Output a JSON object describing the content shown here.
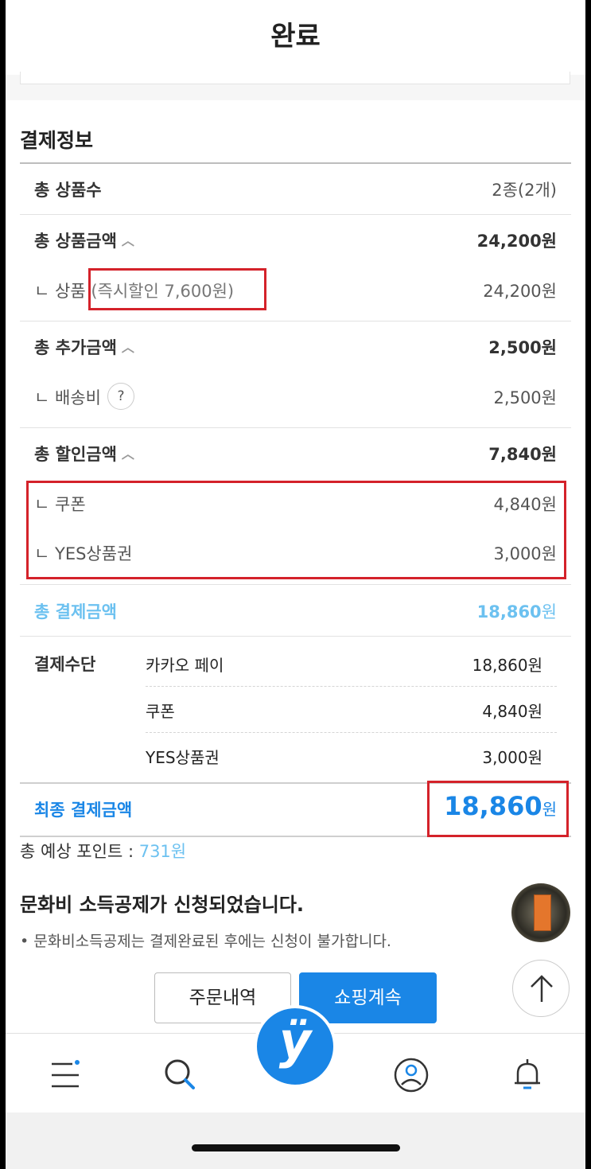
{
  "header": {
    "title": "완료"
  },
  "payment_info": {
    "section_title": "결제정보",
    "total_items": {
      "label": "총 상품수",
      "value": "2종(2개)"
    },
    "total_product_amount": {
      "label": "총 상품금액",
      "value": "24,200원"
    },
    "product_sub": {
      "label": "ㄴ 상품",
      "discount_note": "(즉시할인 7,600원)",
      "value": "24,200원"
    },
    "total_extra_amount": {
      "label": "총 추가금액",
      "value": "2,500원"
    },
    "shipping_sub": {
      "label": "ㄴ 배송비",
      "help": "?",
      "value": "2,500원"
    },
    "total_discount": {
      "label": "총 할인금액",
      "value": "7,840원"
    },
    "coupon_sub": {
      "label": "ㄴ 쿠폰",
      "value": "4,840원"
    },
    "giftcard_sub": {
      "label": "ㄴ YES상품권",
      "value": "3,000원"
    },
    "total_payment": {
      "label": "총 결제금액",
      "value": "18,860",
      "unit": "원"
    },
    "payment_method": {
      "label": "결제수단",
      "items": [
        {
          "name": "카카오 페이",
          "value": "18,860원"
        },
        {
          "name": "쿠폰",
          "value": "4,840원"
        },
        {
          "name": "YES상품권",
          "value": "3,000원"
        }
      ]
    },
    "final_payment": {
      "label": "최종 결제금액",
      "value": "18,860",
      "unit": "원"
    },
    "expected_points": {
      "label": "총 예상 포인트 : ",
      "value": "731원"
    }
  },
  "notice": {
    "title": "문화비 소득공제가 신청되었습니다.",
    "text": "• 문화비소득공제는 결제완료된 후에는 신청이 불가합니다."
  },
  "buttons": {
    "order_history": "주문내역",
    "continue_shopping": "쇼핑계속"
  },
  "tabbar": {
    "logo": "ÿ"
  },
  "colors": {
    "accent": "#1a86e6",
    "light_accent": "#6cc1f0",
    "highlight_box": "#d4222a"
  }
}
